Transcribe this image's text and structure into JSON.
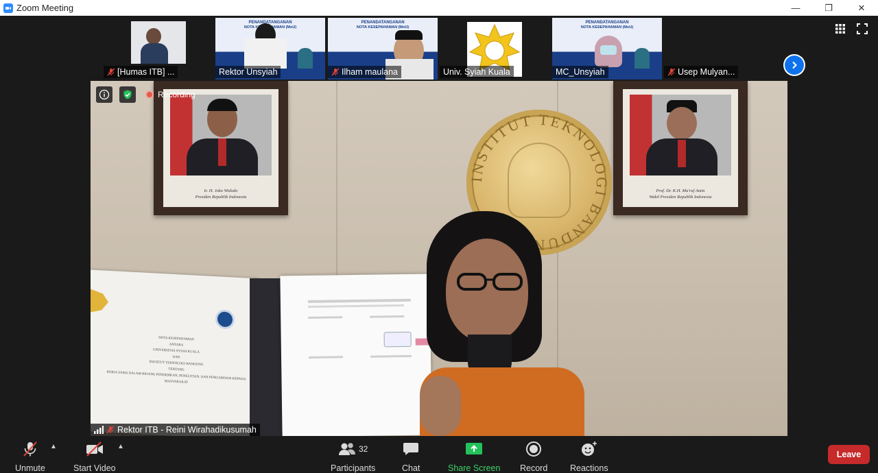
{
  "window": {
    "title": "Zoom Meeting",
    "controls": {
      "minimize": "—",
      "restore": "❐",
      "close": "✕"
    }
  },
  "gallery": {
    "participants": [
      {
        "name": "[Humas ITB] ...",
        "muted": true
      },
      {
        "name": "Rektor Unsyiah",
        "muted": false
      },
      {
        "name": "Ilham maulana",
        "muted": true
      },
      {
        "name": "Univ. Syiah Kuala",
        "muted": false
      },
      {
        "name": "MC_Unsyiah",
        "muted": false
      },
      {
        "name": "Usep Mulyan...",
        "muted": true
      }
    ],
    "slide_text": {
      "line1": "PENANDATANGANAN",
      "line2": "NOTA KESEPAHAMAN (MoU)",
      "line3": "UNIVERSITAS SYIAH KUALA",
      "line4": "INSTITUT TEKNOLOGI BANDUNG"
    }
  },
  "main": {
    "recording_label": "Recording",
    "speaker_name": "Rektor ITB - Reini Wirahadikusumah",
    "portrait_left_caption": "Ir. H. Joko Widodo\nPresiden Republik Indonesia",
    "portrait_right_caption": "Prof. Dr. K.H. Ma'ruf Amin\nWakil Presiden Republik Indonesia",
    "seal_text": "INSTITUT TEKNOLOGI BANDUNG",
    "doc_left_lines": [
      "NOTA KESEPAHAMAN",
      "ANTARA",
      "UNIVERSITAS SYIAH KUALA",
      "DAN",
      "INSTITUT TEKNOLOGI BANDUNG",
      "TENTANG",
      "KERJA SAMA DALAM BIDANG PENDIDIKAN, PENELITIAN, DAN PENGABDIAN KEPADA MASYARAKAT"
    ]
  },
  "toolbar": {
    "unmute_label": "Unmute",
    "start_video_label": "Start Video",
    "participants_label": "Participants",
    "participants_count": "32",
    "chat_label": "Chat",
    "share_label": "Share Screen",
    "record_label": "Record",
    "reactions_label": "Reactions",
    "leave_label": "Leave"
  },
  "colors": {
    "accent_blue": "#0e72ed",
    "share_green": "#3dd16a",
    "leave_red": "#c62a2a",
    "muted_red": "#e0443a"
  }
}
